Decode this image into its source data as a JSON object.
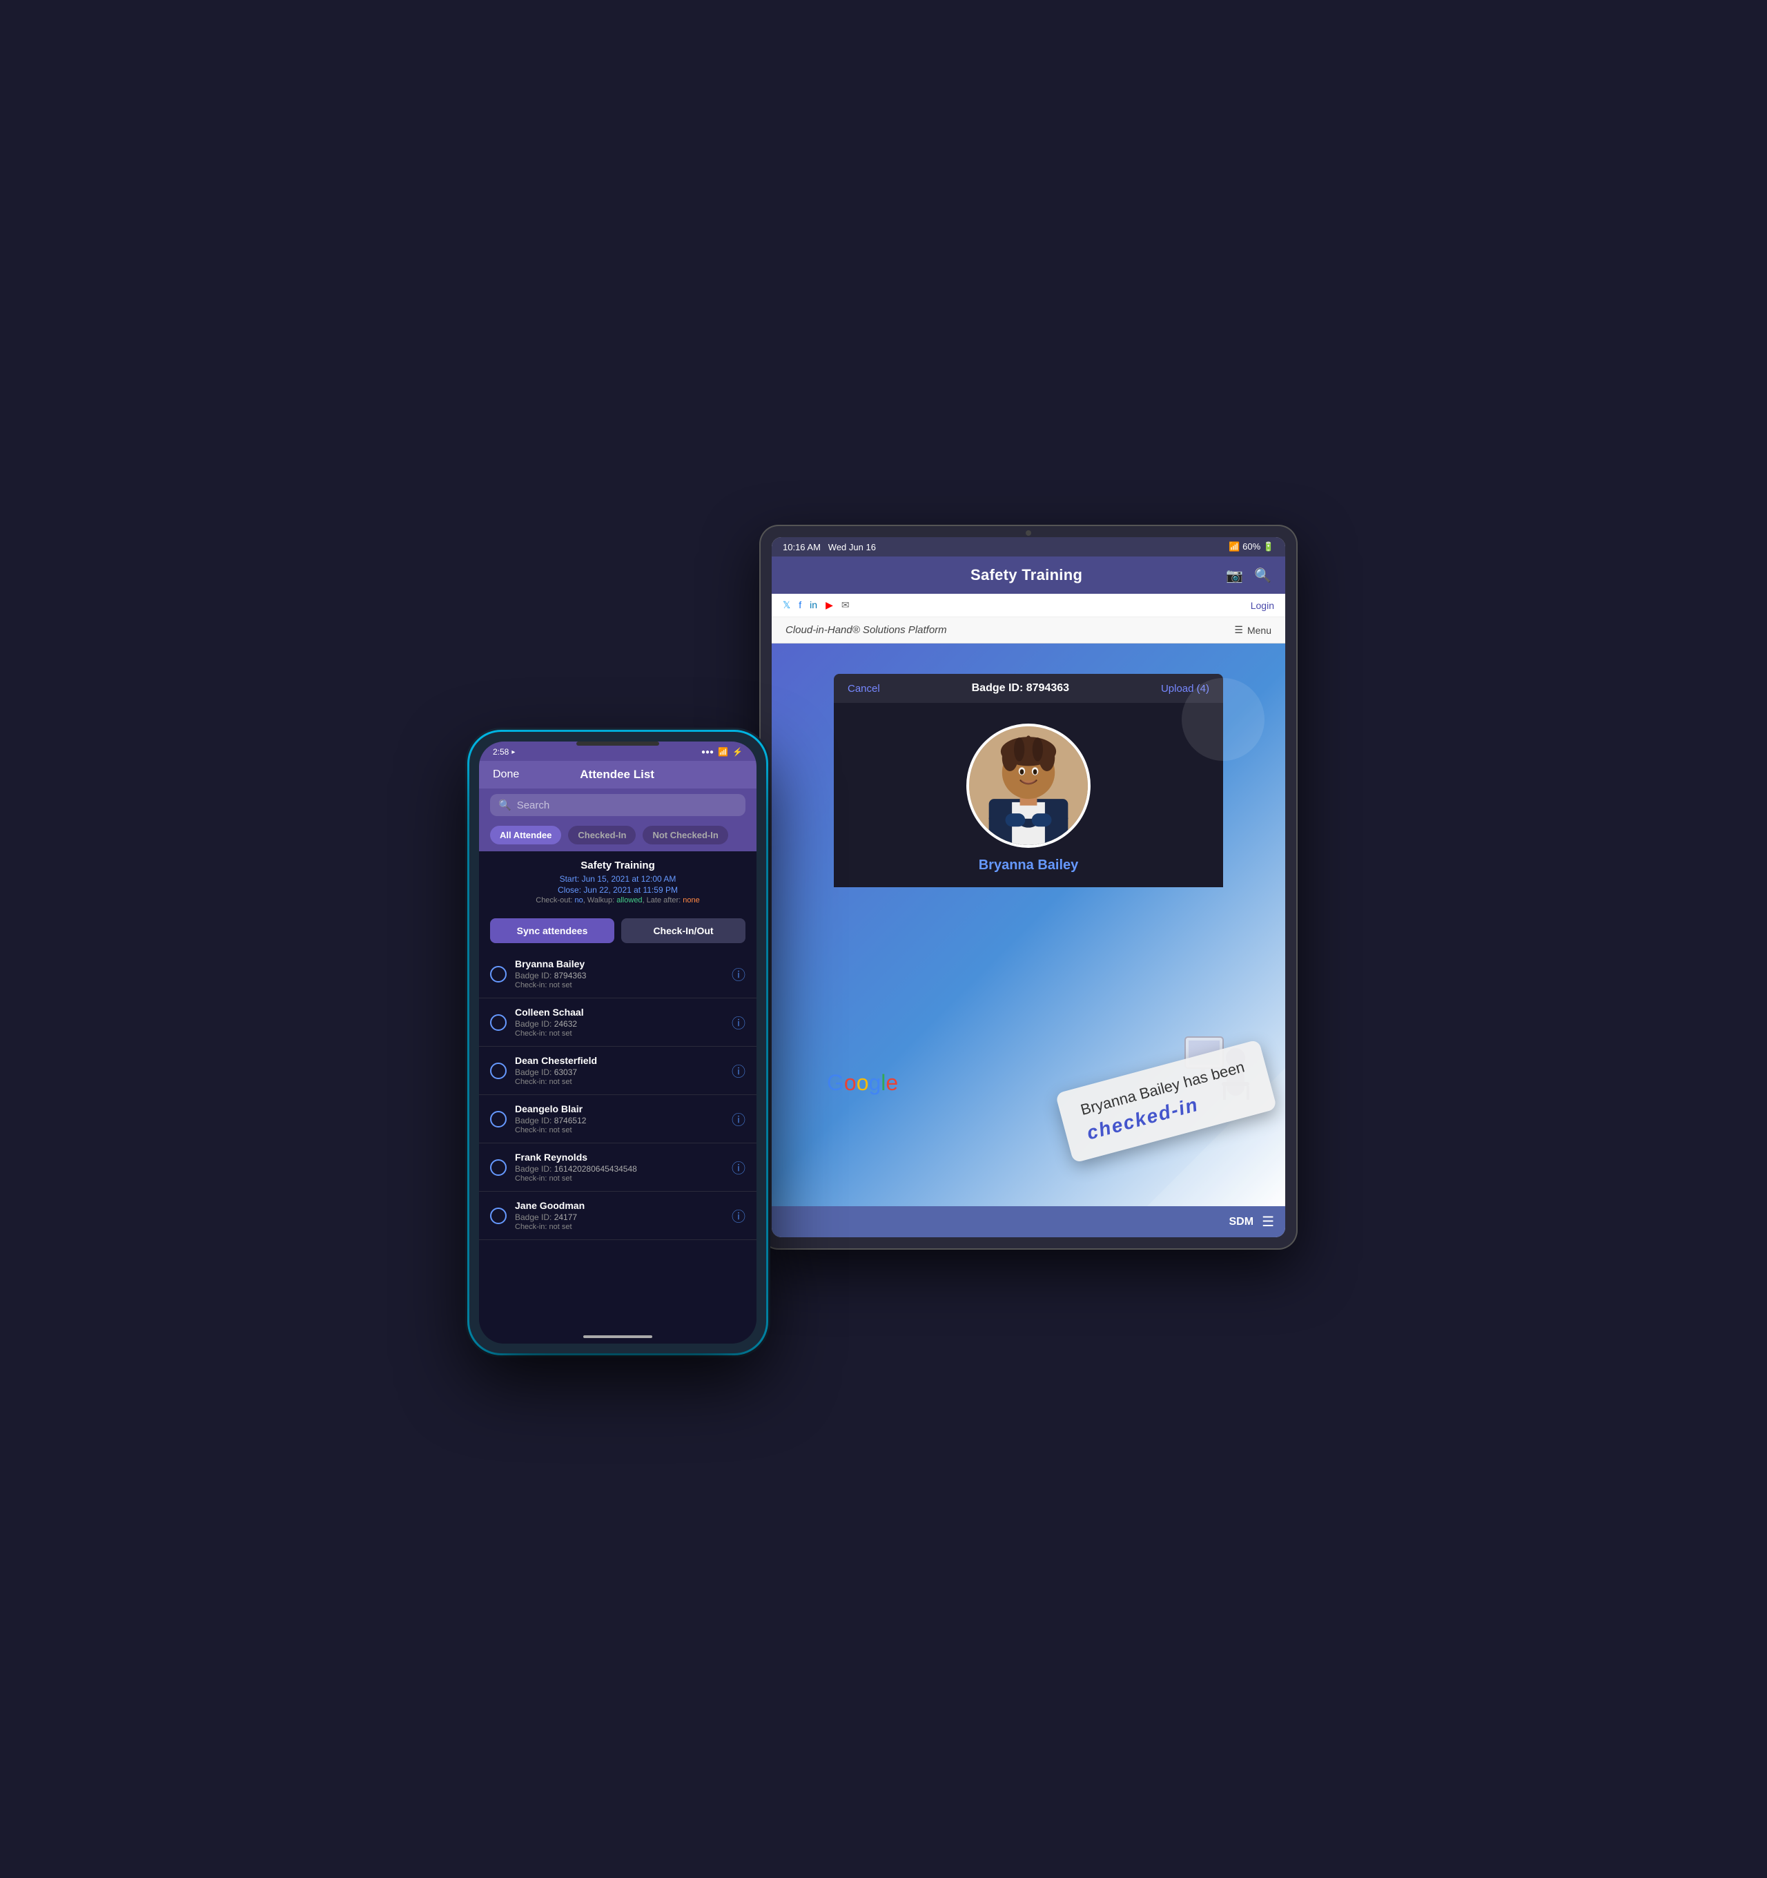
{
  "tablet": {
    "status": {
      "time": "10:16 AM",
      "date": "Wed Jun 16",
      "battery": "60%"
    },
    "header": {
      "title": "Safety Training",
      "camera_icon": "camera",
      "search_icon": "search"
    },
    "social_bar": {
      "icons": [
        "twitter",
        "facebook",
        "linkedin",
        "youtube",
        "email"
      ],
      "login_label": "Login"
    },
    "branding": {
      "text": "Cloud-in-Hand® Solutions Platform",
      "menu_label": "Menu"
    },
    "badge_bar": {
      "cancel_label": "Cancel",
      "badge_id": "Badge ID: 8794363",
      "upload_label": "Upload (4)"
    },
    "attendee": {
      "name": "Bryanna Bailey"
    },
    "checked_in_notice": {
      "line1": "Bryanna Bailey has been",
      "line2": "checked-in"
    },
    "google_watermark": "Google",
    "footer": {
      "sdm_label": "SDM",
      "menu_icon": "hamburger"
    }
  },
  "phone": {
    "status": {
      "time": "2:58",
      "location": "▸",
      "signal": "●●●",
      "wifi": "wifi",
      "battery": "⚡"
    },
    "nav": {
      "done_label": "Done",
      "title": "Attendee List"
    },
    "search": {
      "placeholder": "Search"
    },
    "filters": {
      "all_label": "All Attendee",
      "checked_in_label": "Checked-In",
      "not_checked_in_label": "Not Checked-In"
    },
    "event": {
      "title": "Safety Training",
      "start_label": "Start:",
      "start_date": "Jun 15, 2021 at 12:00 AM",
      "close_label": "Close:",
      "close_date": "Jun 22, 2021 at 11:59 PM",
      "options": "Check-out: no, Walkup: allowed, Late after: none"
    },
    "actions": {
      "sync_label": "Sync attendees",
      "checkin_label": "Check-In/Out"
    },
    "attendees": [
      {
        "name": "Bryanna Bailey",
        "badge_id": "8794363",
        "checkin": "not set"
      },
      {
        "name": "Colleen Schaal",
        "badge_id": "24632",
        "checkin": "not set"
      },
      {
        "name": "Dean Chesterfield",
        "badge_id": "63037",
        "checkin": "not set"
      },
      {
        "name": "Deangelo Blair",
        "badge_id": "8746512",
        "checkin": "not set"
      },
      {
        "name": "Frank Reynolds",
        "badge_id": "161420280645434548",
        "checkin": "not set"
      },
      {
        "name": "Jane Goodman",
        "badge_id": "24177",
        "checkin": "not set"
      }
    ]
  }
}
